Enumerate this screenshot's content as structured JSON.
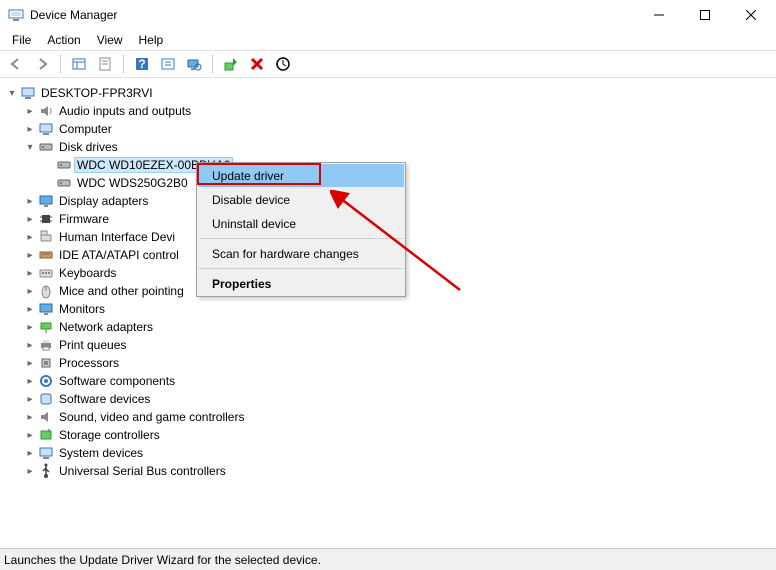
{
  "window": {
    "title": "Device Manager"
  },
  "menu": {
    "file": "File",
    "action": "Action",
    "view": "View",
    "help": "Help"
  },
  "root": "DESKTOP-FPR3RVI",
  "categories": {
    "audio": "Audio inputs and outputs",
    "computer": "Computer",
    "disk": "Disk drives",
    "disk_child1": "WDC WD10EZEX-00BBHA0",
    "disk_child2": "WDC WDS250G2B0",
    "display": "Display adapters",
    "firmware": "Firmware",
    "hid": "Human Interface Devi",
    "ide": "IDE ATA/ATAPI control",
    "keyboards": "Keyboards",
    "mice": "Mice and other pointing",
    "monitors": "Monitors",
    "network": "Network adapters",
    "print": "Print queues",
    "processors": "Processors",
    "swcomp": "Software components",
    "swdev": "Software devices",
    "sound": "Sound, video and game controllers",
    "storage": "Storage controllers",
    "system": "System devices",
    "usb": "Universal Serial Bus controllers"
  },
  "context": {
    "update": "Update driver",
    "disable": "Disable device",
    "uninstall": "Uninstall device",
    "scan": "Scan for hardware changes",
    "properties": "Properties"
  },
  "status": "Launches the Update Driver Wizard for the selected device."
}
